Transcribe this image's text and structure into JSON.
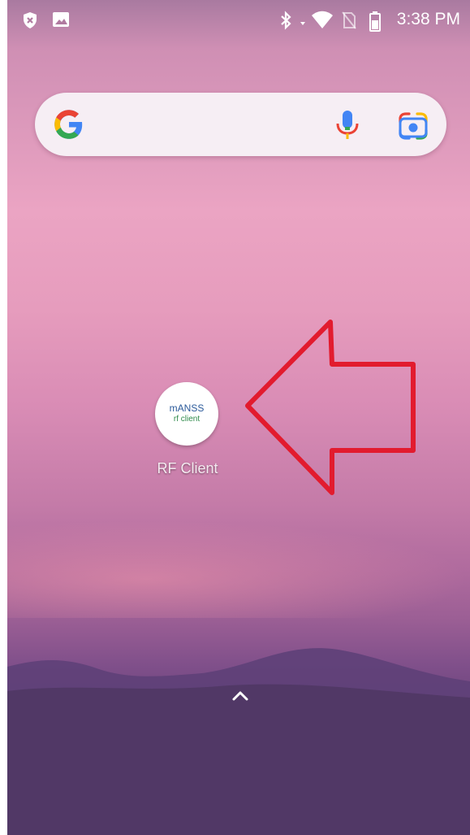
{
  "status_bar": {
    "time": "3:38 PM",
    "left_icons": [
      "security-shield-icon",
      "gallery-notification-icon"
    ],
    "right_icons": [
      "bluetooth-icon",
      "wifi-icon",
      "no-sim-icon",
      "battery-icon"
    ]
  },
  "search_bar": {
    "logo": "google-g-logo",
    "mic_icon": "microphone-icon",
    "lens_icon": "google-lens-icon"
  },
  "home_screen": {
    "apps": [
      {
        "label": "RF Client",
        "icon_text_top": "mАNSS",
        "icon_text_bottom": "rf client"
      }
    ]
  },
  "annotation": {
    "shape": "arrow-left",
    "color": "#e21b2e"
  },
  "app_drawer": {
    "icon": "chevron-up-icon"
  }
}
